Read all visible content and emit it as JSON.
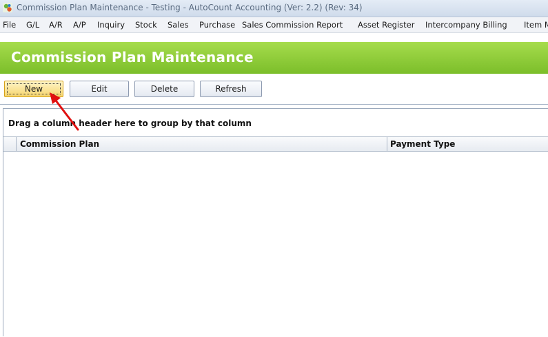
{
  "window": {
    "title": "Commission Plan Maintenance - Testing - AutoCount Accounting (Ver: 2.2) (Rev: 34)",
    "app_icon": "autocount-icon"
  },
  "menu": {
    "items": [
      "File",
      "G/L",
      "A/R",
      "A/P",
      "Inquiry",
      "Stock",
      "Sales",
      "Purchase",
      "Sales Commission Report",
      "Asset Register",
      "Intercompany Billing",
      "Item M"
    ]
  },
  "banner": {
    "title": "Commission Plan Maintenance",
    "color": "#8dcb36"
  },
  "toolbar": {
    "new_label": "New",
    "edit_label": "Edit",
    "delete_label": "Delete",
    "refresh_label": "Refresh"
  },
  "grid": {
    "group_hint": "Drag a column header here to group by that column",
    "columns": [
      "Commission Plan",
      "Payment Type"
    ],
    "rows": []
  },
  "annotation": {
    "arrow_color": "#e01010",
    "target": "new-button"
  }
}
